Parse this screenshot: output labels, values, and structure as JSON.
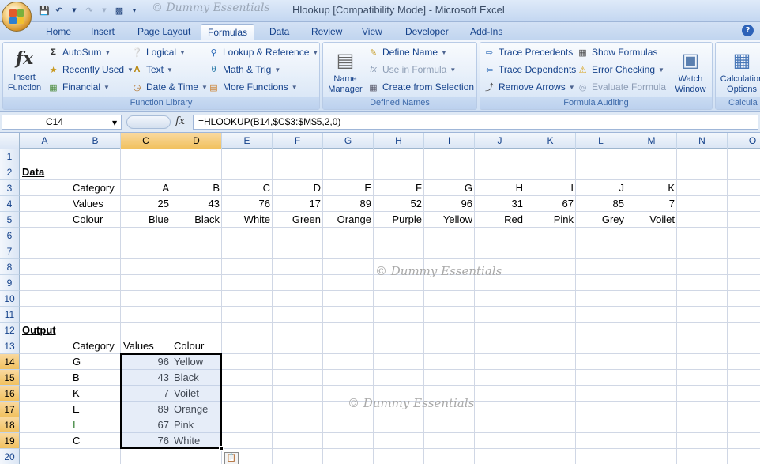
{
  "window": {
    "title": "Hlookup  [Compatibility Mode] - Microsoft Excel",
    "watermark": "© Dummy Essentials"
  },
  "tabs": [
    "Home",
    "Insert",
    "Page Layout",
    "Formulas",
    "Data",
    "Review",
    "View",
    "Developer",
    "Add-Ins"
  ],
  "active_tab": "Formulas",
  "ribbon": {
    "function_library": {
      "label": "Function Library",
      "insert_function": "Insert\nFunction",
      "autosum": "AutoSum",
      "recently_used": "Recently Used",
      "financial": "Financial",
      "logical": "Logical",
      "text": "Text",
      "date_time": "Date & Time",
      "lookup_reference": "Lookup & Reference",
      "math_trig": "Math & Trig",
      "more_functions": "More Functions"
    },
    "defined_names": {
      "label": "Defined Names",
      "name_manager": "Name\nManager",
      "define_name": "Define Name",
      "use_in_formula": "Use in Formula",
      "create_from_selection": "Create from Selection"
    },
    "formula_auditing": {
      "label": "Formula Auditing",
      "trace_precedents": "Trace Precedents",
      "trace_dependents": "Trace Dependents",
      "remove_arrows": "Remove Arrows",
      "show_formulas": "Show Formulas",
      "error_checking": "Error Checking",
      "evaluate_formula": "Evaluate Formula",
      "watch_window": "Watch\nWindow"
    },
    "calculation": {
      "label": "Calcula",
      "calculation_options": "Calculation\nOptions"
    }
  },
  "formula_bar": {
    "name_box": "C14",
    "formula": "=HLOOKUP(B14,$C$3:$M$5,2,0)"
  },
  "columns": [
    "A",
    "B",
    "C",
    "D",
    "E",
    "F",
    "G",
    "H",
    "I",
    "J",
    "K",
    "L",
    "M",
    "N",
    "O"
  ],
  "selected_columns": [
    "C",
    "D"
  ],
  "rows": [
    "1",
    "2",
    "3",
    "4",
    "5",
    "6",
    "7",
    "8",
    "9",
    "10",
    "11",
    "12",
    "13",
    "14",
    "15",
    "16",
    "17",
    "18",
    "19",
    "20"
  ],
  "selected_rows": [
    "14",
    "15",
    "16",
    "17",
    "18",
    "19"
  ],
  "sheet": {
    "data_heading": "Data",
    "data_table": {
      "row_labels": [
        "Category",
        "Values",
        "Colour"
      ],
      "categories": [
        "A",
        "B",
        "C",
        "D",
        "E",
        "F",
        "G",
        "H",
        "I",
        "J",
        "K"
      ],
      "values": [
        "25",
        "43",
        "76",
        "17",
        "89",
        "52",
        "96",
        "31",
        "67",
        "85",
        "7"
      ],
      "colours": [
        "Blue",
        "Black",
        "White",
        "Green",
        "Orange",
        "Purple",
        "Yellow",
        "Red",
        "Pink",
        "Grey",
        "Voilet"
      ]
    },
    "output_heading": "Output",
    "output_table": {
      "headers": [
        "Category",
        "Values",
        "Colour"
      ],
      "rows": [
        [
          "G",
          "96",
          "Yellow"
        ],
        [
          "B",
          "43",
          "Black"
        ],
        [
          "K",
          "7",
          "Voilet"
        ],
        [
          "E",
          "89",
          "Orange"
        ],
        [
          "I",
          "67",
          "Pink"
        ],
        [
          "C",
          "76",
          "White"
        ]
      ]
    },
    "watermark1": "© Dummy Essentials",
    "watermark2": "© Dummy Essentials"
  }
}
